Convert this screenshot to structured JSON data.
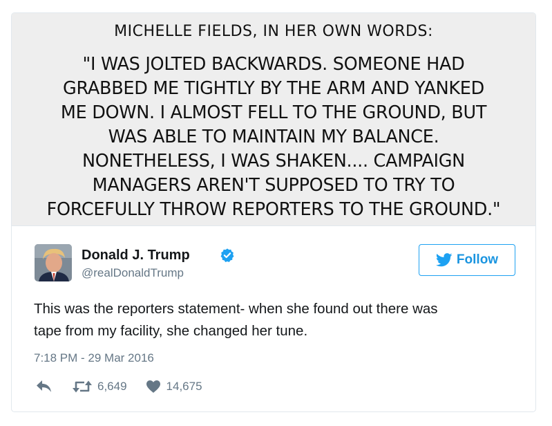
{
  "quote": {
    "title": "MICHELLE FIELDS, IN HER OWN WORDS:",
    "lines": [
      "\"I WAS JOLTED BACKWARDS. SOMEONE HAD",
      "GRABBED ME TIGHTLY BY THE ARM AND YANKED",
      "ME DOWN. I ALMOST FELL TO THE GROUND, BUT",
      "WAS ABLE TO MAINTAIN MY BALANCE.",
      "NONETHELESS, I WAS SHAKEN.... CAMPAIGN",
      "MANAGERS AREN'T SUPPOSED TO TRY TO",
      "FORCEFULLY THROW REPORTERS TO THE GROUND.\""
    ]
  },
  "user": {
    "name": "Donald J. Trump",
    "handle": "@realDonaldTrump",
    "verified": true
  },
  "follow_button": {
    "label": "Follow",
    "icon": "twitter-bird-icon"
  },
  "tweet": {
    "lines": [
      "This was the reporters statement- when she found out there was",
      "tape from my facility, she changed her tune."
    ],
    "timestamp": "7:18 PM - 29 Mar 2016"
  },
  "actions": {
    "reply_icon": "reply-icon",
    "retweet_icon": "retweet-icon",
    "retweet_count": "6,649",
    "like_icon": "heart-icon",
    "like_count": "14,675"
  },
  "colors": {
    "brand_blue": "#1da1f2",
    "text": "#14171a",
    "muted": "#657786",
    "border": "#e1e8ed",
    "quote_bg": "#eeeeee"
  }
}
